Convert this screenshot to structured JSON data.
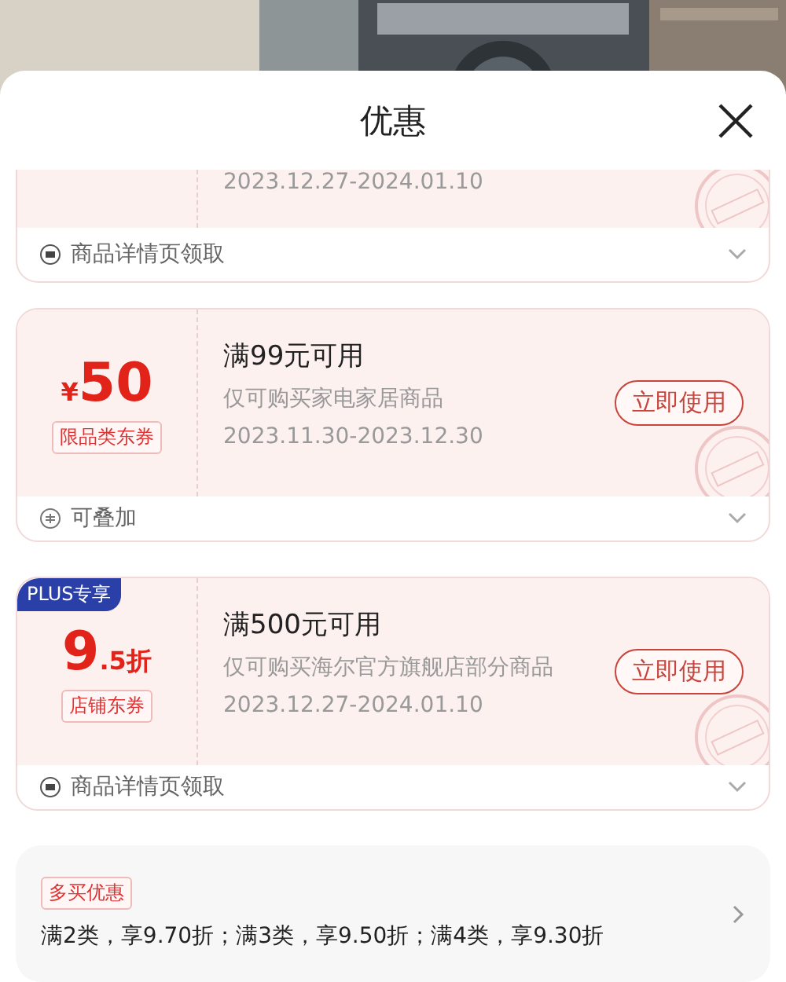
{
  "sheet": {
    "title": "优惠"
  },
  "coupons": [
    {
      "kind": "partial",
      "dates": "2023.12.27-2024.01.10",
      "claimed": true,
      "footer": {
        "kind": "source",
        "text": "商品详情页领取"
      }
    },
    {
      "kind": "full",
      "value": {
        "prefix": "¥",
        "main": "50"
      },
      "tag": "限品类东券",
      "condition": "满99元可用",
      "scope": "仅可购买家电家居商品",
      "dates": "2023.11.30-2023.12.30",
      "action": "立即使用",
      "claimed": true,
      "footer": {
        "kind": "stackable",
        "text": "可叠加"
      }
    },
    {
      "kind": "full",
      "badge": "PLUS专享",
      "value": {
        "main": "9",
        "suffix": ".5折"
      },
      "tag": "店铺东券",
      "condition": "满500元可用",
      "scope": "仅可购买海尔官方旗舰店部分商品",
      "dates": "2023.12.27-2024.01.10",
      "action": "立即使用",
      "claimed": true,
      "footer": {
        "kind": "source",
        "text": "商品详情页领取"
      }
    }
  ],
  "multi_buy": {
    "tag": "多买优惠",
    "text": "满2类，享9.70折；满3类，享9.50折；满4类，享9.30折"
  }
}
